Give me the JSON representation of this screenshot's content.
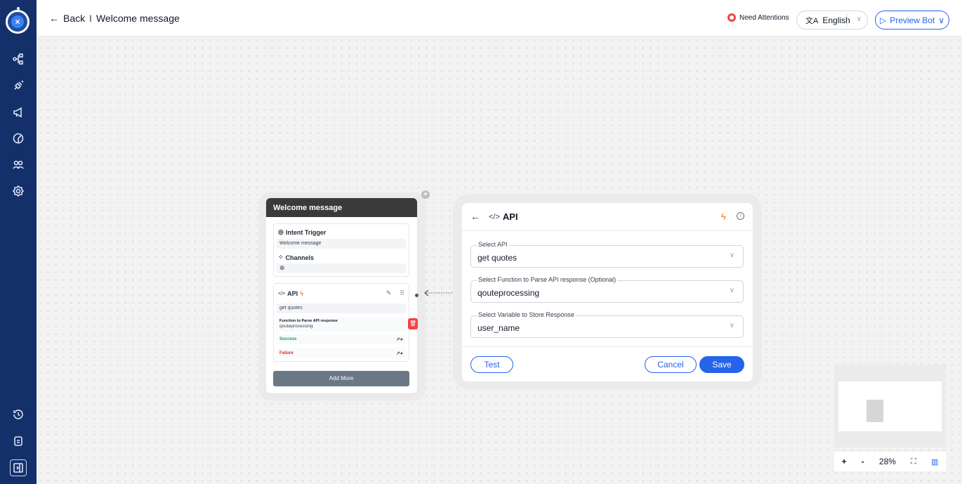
{
  "header": {
    "back_label": "Back",
    "separator": "I",
    "title": "Welcome message",
    "need_attentions": "Need Attentions",
    "language": "English",
    "preview_label": "Preview Bot"
  },
  "node": {
    "title": "Welcome message",
    "intent_trigger_label": "Intent Trigger",
    "intent_value": "Welcome message",
    "channels_label": "Channels",
    "api_label": "API",
    "api_value": "get quotes",
    "function_label": "Function to Parse API response",
    "function_value": "qouteprocessing",
    "success_label": "Success",
    "failure_label": "Failure",
    "add_more_label": "Add More"
  },
  "panel": {
    "title": "API",
    "fields": [
      {
        "label": "Select API",
        "value": "get quotes"
      },
      {
        "label": "Select Function to Parse API response (Optional)",
        "value": "qouteprocessing"
      },
      {
        "label": "Select Variable to Store Response",
        "value": "user_name"
      }
    ],
    "test_label": "Test",
    "cancel_label": "Cancel",
    "save_label": "Save"
  },
  "zoom": {
    "plus": "+",
    "minus": "-",
    "level": "28%"
  },
  "colors": {
    "sidebar": "#14306b",
    "accent": "#2563eb",
    "success": "#16a34a",
    "failure": "#dc2626",
    "bolt": "#f97316"
  }
}
